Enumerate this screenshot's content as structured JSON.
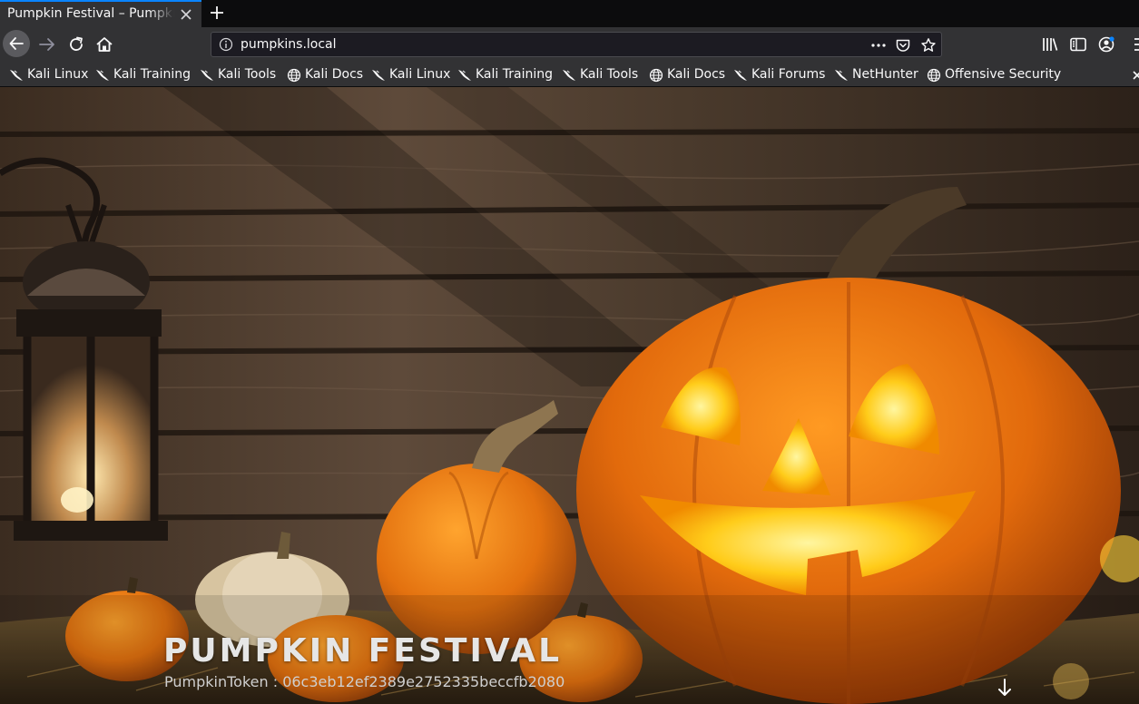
{
  "browser": {
    "tab": {
      "title": "Pumpkin Festival – Pumpkin Festival"
    },
    "url": "pumpkins.local",
    "icons": {
      "back": "back-arrow-icon",
      "forward": "forward-arrow-icon",
      "reload": "reload-icon",
      "home": "home-icon",
      "page_actions": "ellipsis-icon",
      "pocket": "pocket-icon",
      "bookmark_star": "star-icon",
      "library": "library-icon",
      "sidebar": "sidebar-icon",
      "account": "account-icon",
      "menu": "hamburger-icon"
    },
    "bookmarks": [
      {
        "label": "Kali Linux",
        "icon": "kali-dragon-icon"
      },
      {
        "label": "Kali Training",
        "icon": "kali-dragon-icon"
      },
      {
        "label": "Kali Tools",
        "icon": "kali-dragon-icon"
      },
      {
        "label": "Kali Docs",
        "icon": "globe-icon"
      },
      {
        "label": "Kali Linux",
        "icon": "kali-dragon-icon"
      },
      {
        "label": "Kali Training",
        "icon": "kali-dragon-icon"
      },
      {
        "label": "Kali Tools",
        "icon": "kali-dragon-icon"
      },
      {
        "label": "Kali Docs",
        "icon": "globe-icon"
      },
      {
        "label": "Kali Forums",
        "icon": "kali-dragon-icon"
      },
      {
        "label": "NetHunter",
        "icon": "kali-dragon-icon"
      },
      {
        "label": "Offensive Security",
        "icon": "globe-icon"
      }
    ]
  },
  "page": {
    "hero_title": "PUMPKIN FESTIVAL",
    "token_text": "PumpkinToken : 06c3eb12ef2389e2752335beccfb2080",
    "scroll_icon": "arrow-down-icon"
  },
  "colors": {
    "chrome_dark": "#0c0c0d",
    "toolbar": "#323234",
    "accent": "#0a84ff",
    "pumpkin_orange": "#e8730f"
  }
}
